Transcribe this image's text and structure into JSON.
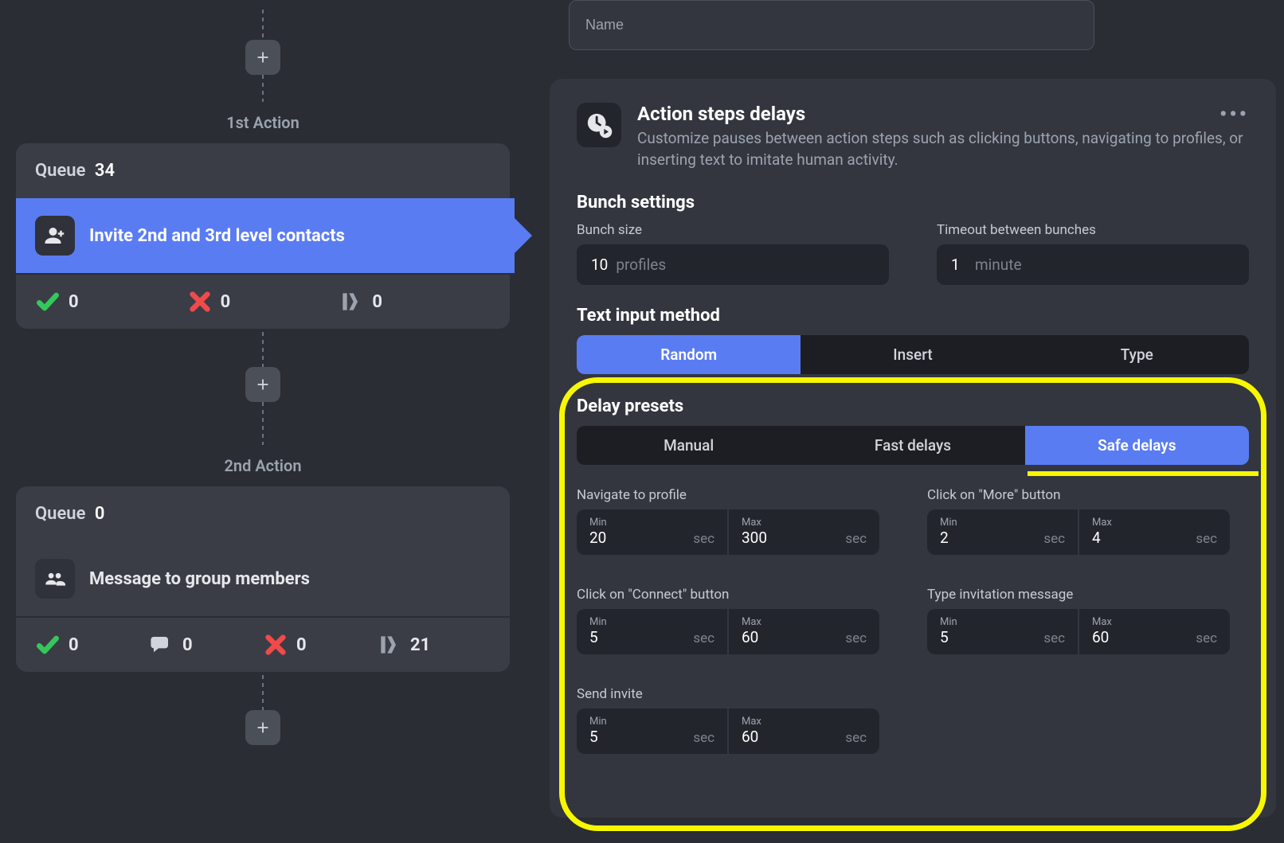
{
  "name_placeholder": "Name",
  "left": {
    "actions": [
      {
        "heading": "1st Action",
        "queue_label": "Queue",
        "queue_count": "34",
        "item_label": "Invite 2nd and 3rd level contacts",
        "selected": true,
        "stats": {
          "success": "0",
          "fail": "0",
          "skipped": "0"
        }
      },
      {
        "heading": "2nd Action",
        "queue_label": "Queue",
        "queue_count": "0",
        "item_label": "Message to group members",
        "selected": false,
        "stats": {
          "success": "0",
          "replies": "0",
          "fail": "0",
          "skipped": "21"
        }
      }
    ]
  },
  "config": {
    "title": "Action steps delays",
    "desc": "Customize pauses between action steps such as clicking buttons, navigating to profiles, or inserting text to imitate human activity.",
    "bunch_heading": "Bunch settings",
    "bunch_size_label": "Bunch size",
    "bunch_size_value": "10",
    "bunch_size_unit": "profiles",
    "timeout_label": "Timeout between bunches",
    "timeout_value": "1",
    "timeout_unit": "minute",
    "text_method_heading": "Text input method",
    "text_methods": [
      "Random",
      "Insert",
      "Type"
    ],
    "text_method_active": "Random",
    "delay_presets_heading": "Delay presets",
    "delay_presets": [
      "Manual",
      "Fast delays",
      "Safe delays"
    ],
    "delay_preset_active": "Safe delays",
    "min_label": "Min",
    "max_label": "Max",
    "sec_label": "sec",
    "delays": [
      {
        "label": "Navigate to profile",
        "min": "20",
        "max": "300"
      },
      {
        "label": "Click on \"More\" button",
        "min": "2",
        "max": "4"
      },
      {
        "label": "Click on \"Connect\" button",
        "min": "5",
        "max": "60"
      },
      {
        "label": "Type invitation message",
        "min": "5",
        "max": "60"
      },
      {
        "label": "Send invite",
        "min": "5",
        "max": "60"
      }
    ]
  }
}
